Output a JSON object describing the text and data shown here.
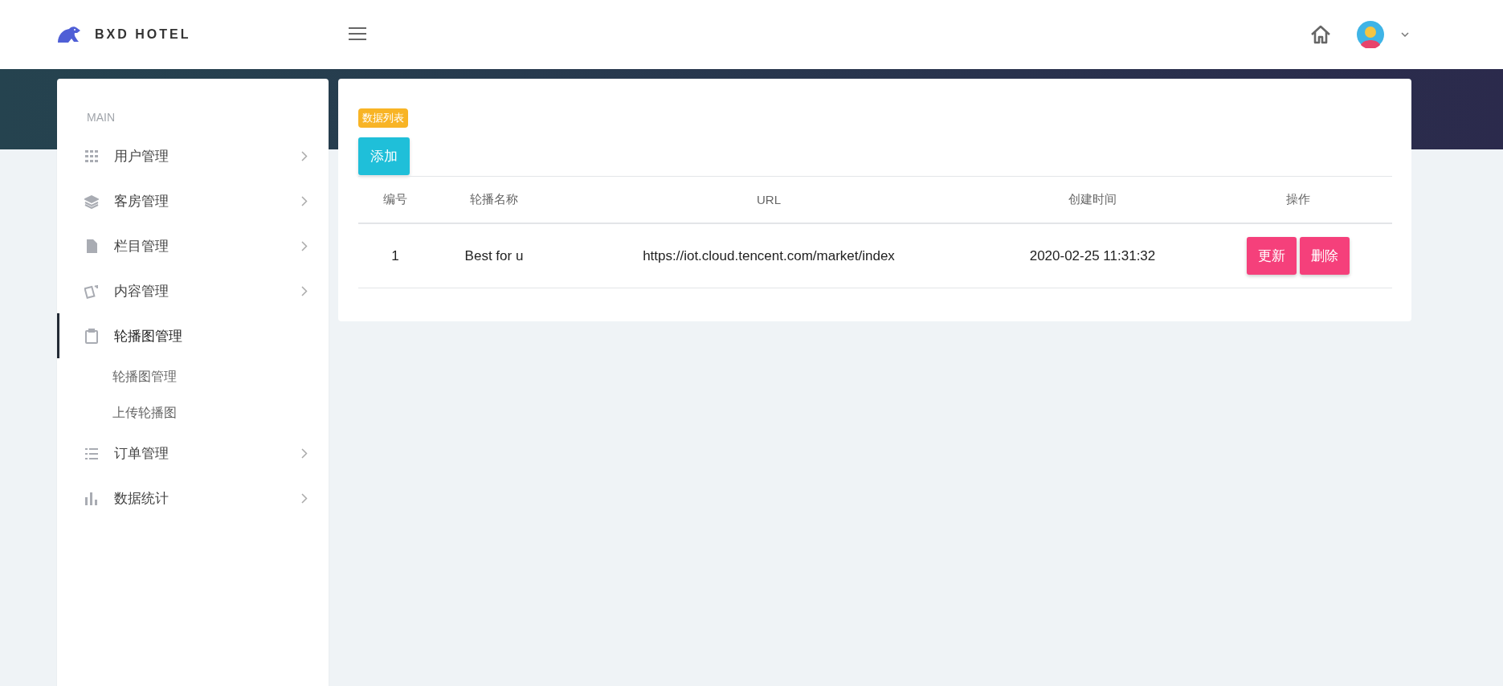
{
  "header": {
    "brand": "BXD HOTEL"
  },
  "sidebar": {
    "section": "MAIN",
    "items": [
      {
        "label": "用户管理",
        "selected": false,
        "expanded": false
      },
      {
        "label": "客房管理",
        "selected": false,
        "expanded": false
      },
      {
        "label": "栏目管理",
        "selected": false,
        "expanded": false
      },
      {
        "label": "内容管理",
        "selected": false,
        "expanded": false
      },
      {
        "label": "轮播图管理",
        "selected": true,
        "expanded": true,
        "children": [
          {
            "label": "轮播图管理"
          },
          {
            "label": "上传轮播图"
          }
        ]
      },
      {
        "label": "订单管理",
        "selected": false,
        "expanded": false
      },
      {
        "label": "数据统计",
        "selected": false,
        "expanded": false
      }
    ]
  },
  "content": {
    "badge": "数据列表",
    "add_button": "添加",
    "table": {
      "columns": [
        "编号",
        "轮播名称",
        "URL",
        "创建时间",
        "操作"
      ],
      "rows": [
        {
          "cells": [
            "1",
            "Best for u",
            "https://iot.cloud.tencent.com/market/index",
            "2020-02-25 11:31:32"
          ],
          "actions": [
            "更新",
            "删除"
          ]
        }
      ]
    }
  }
}
